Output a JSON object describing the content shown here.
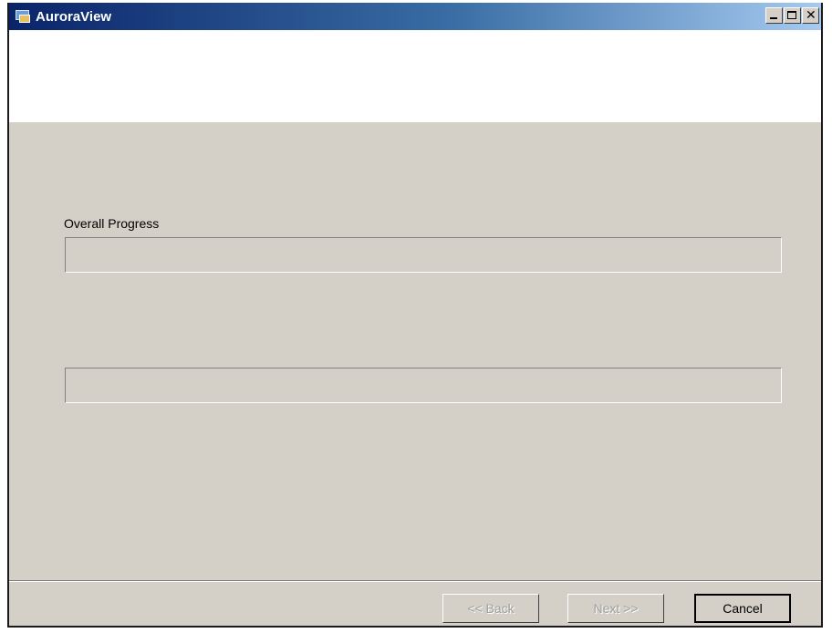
{
  "window": {
    "title": "AuroraView",
    "icon": "app-icon"
  },
  "title_buttons": {
    "minimize": "minimize-icon",
    "maximize": "maximize-icon",
    "close": "close-icon"
  },
  "progress": {
    "overall_label": "Overall Progress",
    "overall_value": 0,
    "secondary_value": 0
  },
  "buttons": {
    "back_label": "<< Back",
    "next_label": "Next >>",
    "cancel_label": "Cancel"
  },
  "colors": {
    "titlebar_start": "#0a246a",
    "titlebar_end": "#a6caf0",
    "dialog_background": "#d4d0c8"
  }
}
